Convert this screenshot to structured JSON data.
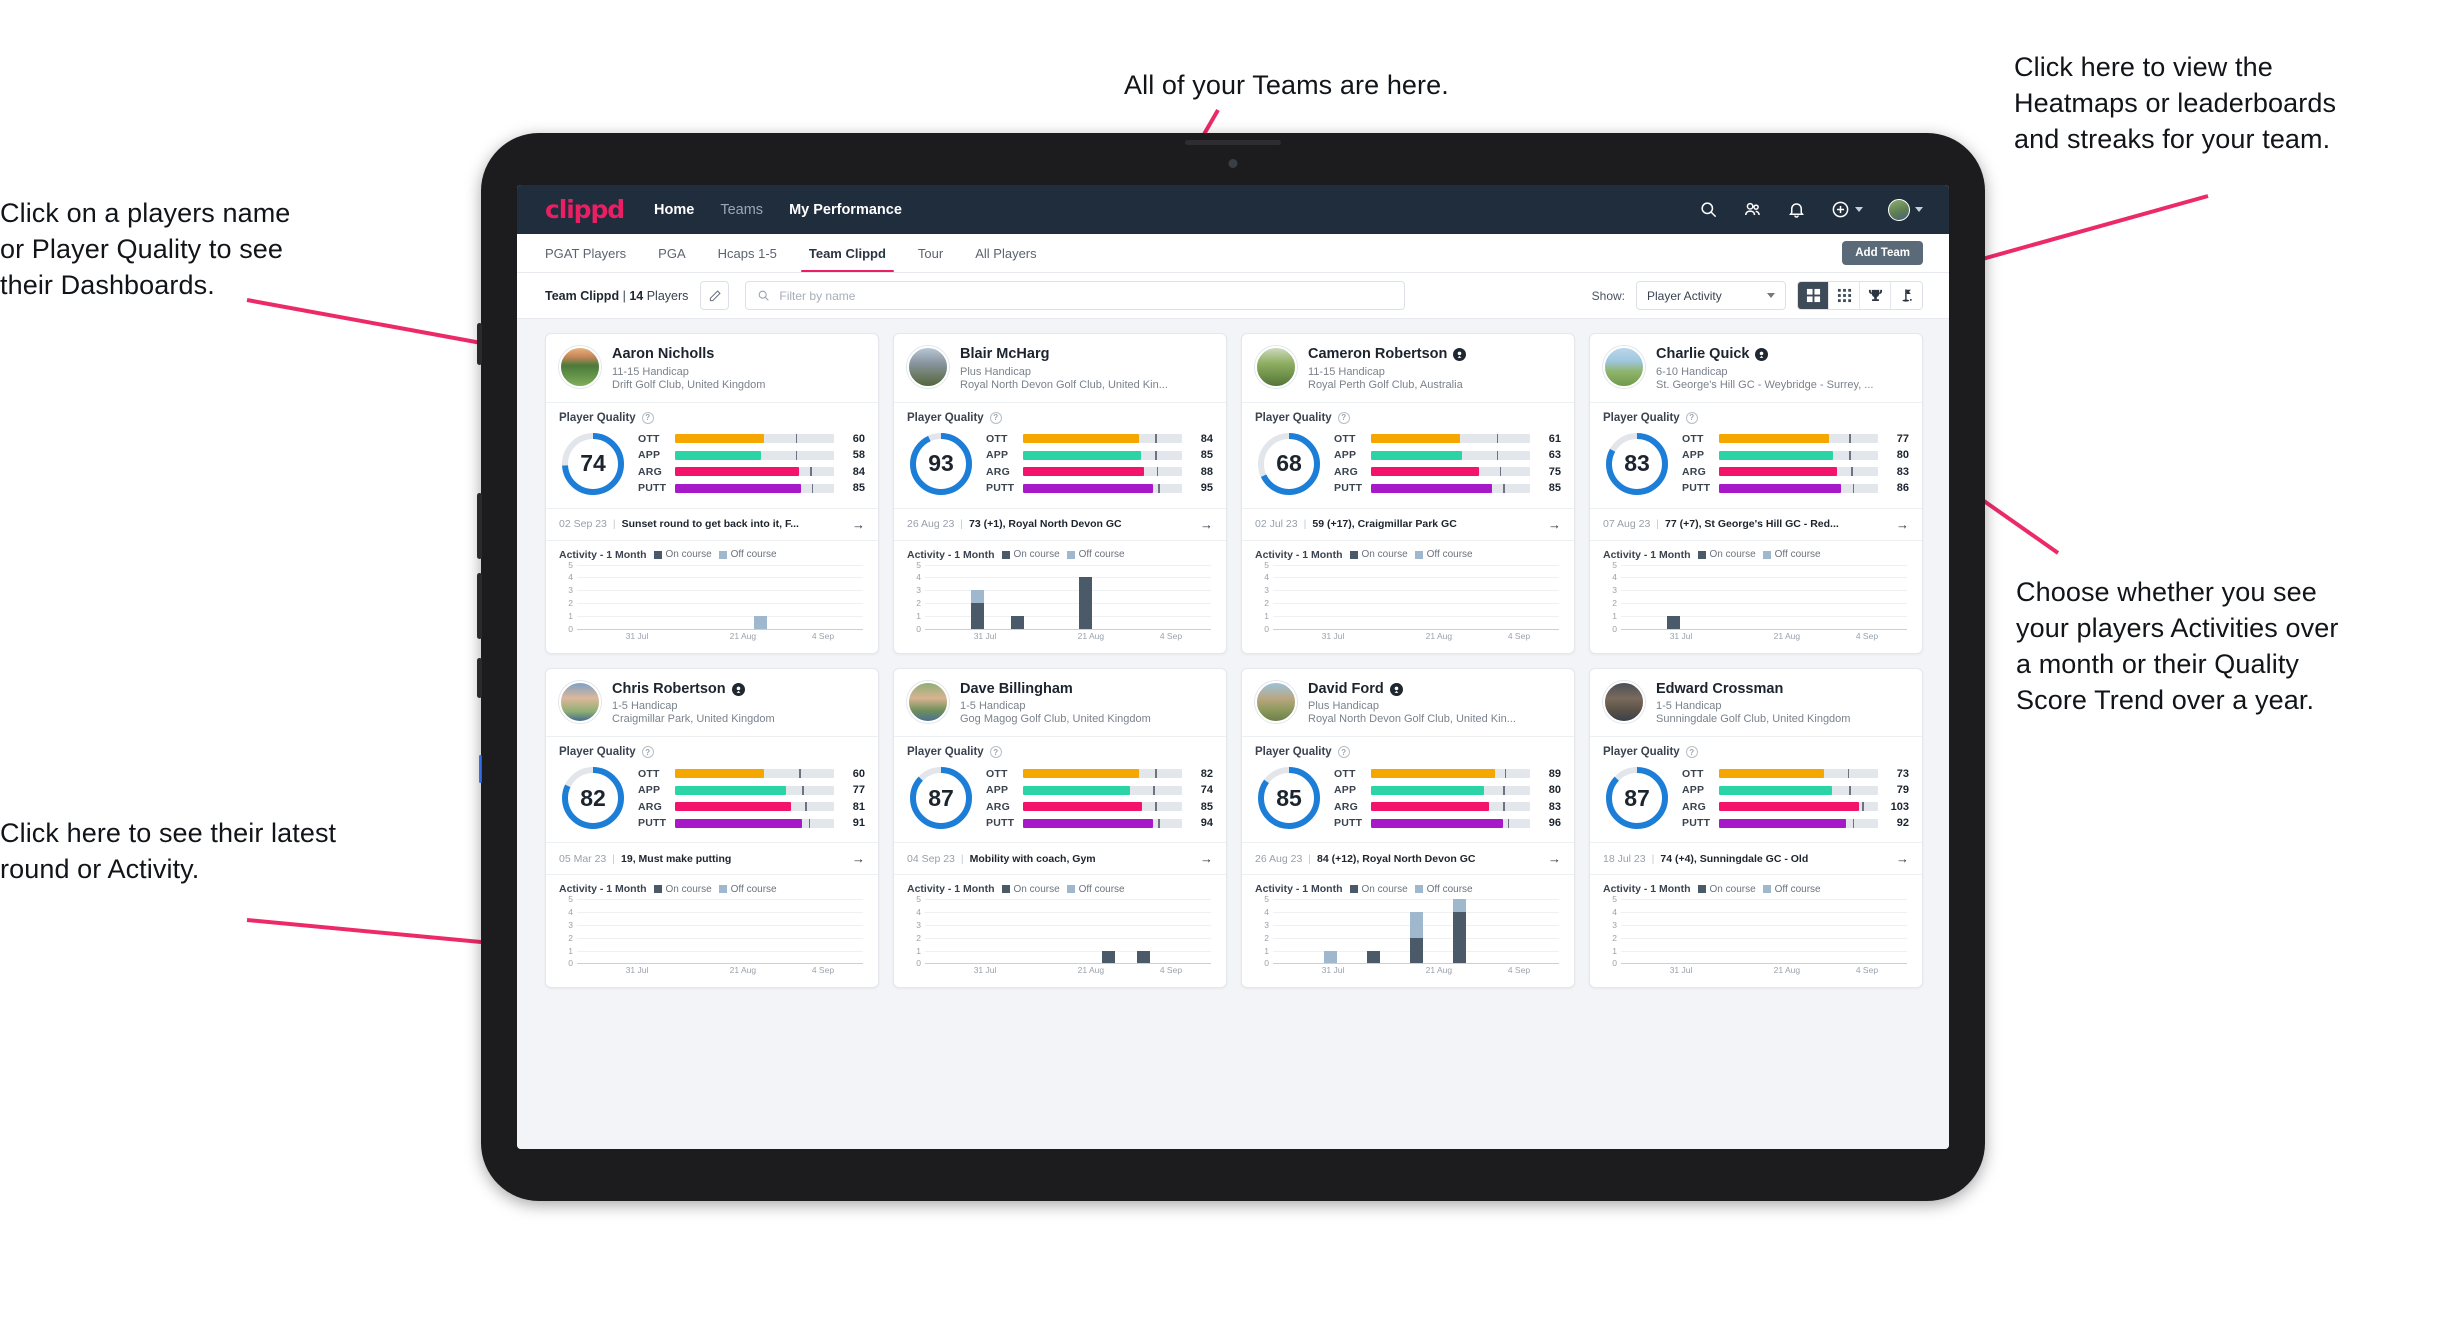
{
  "annotations": [
    {
      "id": "teams-note",
      "text": "All of your Teams are here."
    },
    {
      "id": "heatmap-note",
      "text": "Click here to view the\nHeatmaps or leaderboards\nand streaks for your team."
    },
    {
      "id": "player-name-note",
      "text": "Click on a players name\nor Player Quality to see\ntheir Dashboards."
    },
    {
      "id": "show-note",
      "text": "Choose whether you see\nyour players Activities over\na month or their Quality\nScore Trend over a year."
    },
    {
      "id": "latest-round-note",
      "text": "Click here to see their latest\nround or Activity."
    }
  ],
  "colors": {
    "brand_pink": "#e91e63",
    "nav_dark": "#1f2d3d",
    "accent_blue": "#1d7ed8",
    "ott": "#f5a700",
    "app": "#2bd4a4",
    "arg": "#f4136a",
    "putt": "#a718c9",
    "on_course": "#4a5a68",
    "off_course": "#9fb8cd",
    "annotation_arrow": "#ec2a68"
  },
  "topnav": {
    "brand": "clippd",
    "links": [
      {
        "label": "Home",
        "active": true
      },
      {
        "label": "Teams",
        "active": false
      },
      {
        "label": "My Performance",
        "active": true
      }
    ],
    "icons": [
      {
        "name": "search-icon"
      },
      {
        "name": "people-icon"
      },
      {
        "name": "bell-icon"
      },
      {
        "name": "plus-circle-icon"
      },
      {
        "name": "avatar"
      }
    ]
  },
  "subnav": {
    "tabs": [
      {
        "label": "PGAT Players",
        "active": false
      },
      {
        "label": "PGA",
        "active": false
      },
      {
        "label": "Hcaps 1-5",
        "active": false
      },
      {
        "label": "Team Clippd",
        "active": true
      },
      {
        "label": "Tour",
        "active": false
      },
      {
        "label": "All Players",
        "active": false
      }
    ],
    "add_team_label": "Add Team"
  },
  "filterbar": {
    "team_name": "Team Clippd",
    "separator": "|",
    "player_count": "14",
    "players_word": "Players",
    "edit_icon": "pencil-icon",
    "search_placeholder": "Filter by name",
    "search_value": "",
    "show_label": "Show:",
    "show_value": "Player Activity",
    "show_options": [
      "Player Activity",
      "Quality Score Trend"
    ],
    "view_buttons": [
      {
        "name": "grid-view-icon",
        "active": true
      },
      {
        "name": "dots-grid-view-icon",
        "active": false
      },
      {
        "name": "trophy-view-icon",
        "active": false
      },
      {
        "name": "flag-view-icon",
        "active": false
      }
    ]
  },
  "card_labels": {
    "player_quality": "Player Quality",
    "activity_title": "Activity - 1 Month",
    "legend_on": "On course",
    "legend_off": "Off course",
    "metric_labels": [
      "OTT",
      "APP",
      "ARG",
      "PUTT"
    ],
    "arrow": "→"
  },
  "chart_data": {
    "type": "bar",
    "title": "Activity - 1 Month",
    "xlabel": "",
    "ylabel": "",
    "ylim": [
      0,
      5
    ],
    "grid": true,
    "stacked": true,
    "legend": [
      "On course",
      "Off course"
    ],
    "legend_position": "top",
    "tick_labels_x": [
      "31 Jul",
      "21 Aug",
      "4 Sep"
    ],
    "tick_labels_y": [
      "0",
      "1",
      "2",
      "3",
      "4",
      "5"
    ],
    "charts": [
      {
        "player": "Aaron Nicholls",
        "bars": [
          {
            "pos": 0.62,
            "on": 0,
            "off": 1
          }
        ]
      },
      {
        "player": "Blair McHarg",
        "bars": [
          {
            "pos": 0.16,
            "on": 2,
            "off": 1
          },
          {
            "pos": 0.3,
            "on": 1,
            "off": 0
          },
          {
            "pos": 0.54,
            "on": 4,
            "off": 0
          }
        ]
      },
      {
        "player": "Cameron Robertson",
        "bars": []
      },
      {
        "player": "Charlie Quick",
        "bars": [
          {
            "pos": 0.16,
            "on": 1,
            "off": 0
          }
        ]
      },
      {
        "player": "Chris Robertson",
        "bars": []
      },
      {
        "player": "Dave Billingham",
        "bars": [
          {
            "pos": 0.62,
            "on": 1,
            "off": 0
          },
          {
            "pos": 0.74,
            "on": 1,
            "off": 0
          }
        ]
      },
      {
        "player": "David Ford",
        "bars": [
          {
            "pos": 0.18,
            "on": 0,
            "off": 1
          },
          {
            "pos": 0.33,
            "on": 1,
            "off": 0
          },
          {
            "pos": 0.48,
            "on": 2,
            "off": 2
          },
          {
            "pos": 0.63,
            "on": 4,
            "off": 1
          }
        ]
      },
      {
        "player": "Edward Crossman",
        "bars": []
      }
    ]
  },
  "players": [
    {
      "name": "Aaron Nicholls",
      "verified": false,
      "avatar_class": "pa1",
      "handicap": "11-15 Handicap",
      "club": "Drift Golf Club, United Kingdom",
      "quality": 74,
      "metrics": [
        {
          "label": "OTT",
          "value": 60,
          "color": "#f5a700",
          "fill_pct": 56,
          "tick_pct": 76
        },
        {
          "label": "APP",
          "value": 58,
          "color": "#2bd4a4",
          "fill_pct": 54,
          "tick_pct": 76
        },
        {
          "label": "ARG",
          "value": 84,
          "color": "#f4136a",
          "fill_pct": 78,
          "tick_pct": 85
        },
        {
          "label": "PUTT",
          "value": 85,
          "color": "#a718c9",
          "fill_pct": 79,
          "tick_pct": 86
        }
      ],
      "round_date": "02 Sep 23",
      "round_text": "Sunset round to get back into it, F..."
    },
    {
      "name": "Blair McHarg",
      "verified": false,
      "avatar_class": "pa2",
      "handicap": "Plus Handicap",
      "club": "Royal North Devon Golf Club, United Kin...",
      "quality": 93,
      "metrics": [
        {
          "label": "OTT",
          "value": 84,
          "color": "#f5a700",
          "fill_pct": 73,
          "tick_pct": 83
        },
        {
          "label": "APP",
          "value": 85,
          "color": "#2bd4a4",
          "fill_pct": 74,
          "tick_pct": 83
        },
        {
          "label": "ARG",
          "value": 88,
          "color": "#f4136a",
          "fill_pct": 76,
          "tick_pct": 84
        },
        {
          "label": "PUTT",
          "value": 95,
          "color": "#a718c9",
          "fill_pct": 82,
          "tick_pct": 85
        }
      ],
      "round_date": "26 Aug 23",
      "round_text": "73 (+1), Royal North Devon GC"
    },
    {
      "name": "Cameron Robertson",
      "verified": true,
      "avatar_class": "pa3",
      "handicap": "11-15 Handicap",
      "club": "Royal Perth Golf Club, Australia",
      "quality": 68,
      "metrics": [
        {
          "label": "OTT",
          "value": 61,
          "color": "#f5a700",
          "fill_pct": 56,
          "tick_pct": 79
        },
        {
          "label": "APP",
          "value": 63,
          "color": "#2bd4a4",
          "fill_pct": 57,
          "tick_pct": 79
        },
        {
          "label": "ARG",
          "value": 75,
          "color": "#f4136a",
          "fill_pct": 68,
          "tick_pct": 81
        },
        {
          "label": "PUTT",
          "value": 85,
          "color": "#a718c9",
          "fill_pct": 76,
          "tick_pct": 83
        }
      ],
      "round_date": "02 Jul 23",
      "round_text": "59 (+17), Craigmillar Park GC"
    },
    {
      "name": "Charlie Quick",
      "verified": true,
      "avatar_class": "pa4",
      "handicap": "6-10 Handicap",
      "club": "St. George's Hill GC - Weybridge - Surrey, ...",
      "quality": 83,
      "metrics": [
        {
          "label": "OTT",
          "value": 77,
          "color": "#f5a700",
          "fill_pct": 69,
          "tick_pct": 82
        },
        {
          "label": "APP",
          "value": 80,
          "color": "#2bd4a4",
          "fill_pct": 72,
          "tick_pct": 82
        },
        {
          "label": "ARG",
          "value": 83,
          "color": "#f4136a",
          "fill_pct": 74,
          "tick_pct": 83
        },
        {
          "label": "PUTT",
          "value": 86,
          "color": "#a718c9",
          "fill_pct": 77,
          "tick_pct": 84
        }
      ],
      "round_date": "07 Aug 23",
      "round_text": "77 (+7), St George's Hill GC - Red..."
    },
    {
      "name": "Chris Robertson",
      "verified": true,
      "avatar_class": "pa5",
      "handicap": "1-5 Handicap",
      "club": "Craigmillar Park, United Kingdom",
      "quality": 82,
      "metrics": [
        {
          "label": "OTT",
          "value": 60,
          "color": "#f5a700",
          "fill_pct": 56,
          "tick_pct": 78
        },
        {
          "label": "APP",
          "value": 77,
          "color": "#2bd4a4",
          "fill_pct": 70,
          "tick_pct": 80
        },
        {
          "label": "ARG",
          "value": 81,
          "color": "#f4136a",
          "fill_pct": 73,
          "tick_pct": 82
        },
        {
          "label": "PUTT",
          "value": 91,
          "color": "#a718c9",
          "fill_pct": 80,
          "tick_pct": 84
        }
      ],
      "round_date": "05 Mar 23",
      "round_text": "19, Must make putting"
    },
    {
      "name": "Dave Billingham",
      "verified": false,
      "avatar_class": "pa6",
      "handicap": "1-5 Handicap",
      "club": "Gog Magog Golf Club, United Kingdom",
      "quality": 87,
      "metrics": [
        {
          "label": "OTT",
          "value": 82,
          "color": "#f5a700",
          "fill_pct": 73,
          "tick_pct": 83
        },
        {
          "label": "APP",
          "value": 74,
          "color": "#2bd4a4",
          "fill_pct": 67,
          "tick_pct": 82
        },
        {
          "label": "ARG",
          "value": 85,
          "color": "#f4136a",
          "fill_pct": 75,
          "tick_pct": 83
        },
        {
          "label": "PUTT",
          "value": 94,
          "color": "#a718c9",
          "fill_pct": 82,
          "tick_pct": 85
        }
      ],
      "round_date": "04 Sep 23",
      "round_text": "Mobility with coach, Gym"
    },
    {
      "name": "David Ford",
      "verified": true,
      "avatar_class": "pa7",
      "handicap": "Plus Handicap",
      "club": "Royal North Devon Golf Club, United Kin...",
      "quality": 85,
      "metrics": [
        {
          "label": "OTT",
          "value": 89,
          "color": "#f5a700",
          "fill_pct": 78,
          "tick_pct": 84
        },
        {
          "label": "APP",
          "value": 80,
          "color": "#2bd4a4",
          "fill_pct": 71,
          "tick_pct": 83
        },
        {
          "label": "ARG",
          "value": 83,
          "color": "#f4136a",
          "fill_pct": 74,
          "tick_pct": 83
        },
        {
          "label": "PUTT",
          "value": 96,
          "color": "#a718c9",
          "fill_pct": 83,
          "tick_pct": 86
        }
      ],
      "round_date": "26 Aug 23",
      "round_text": "84 (+12), Royal North Devon GC"
    },
    {
      "name": "Edward Crossman",
      "verified": false,
      "avatar_class": "pa8",
      "handicap": "1-5 Handicap",
      "club": "Sunningdale Golf Club, United Kingdom",
      "quality": 87,
      "metrics": [
        {
          "label": "OTT",
          "value": 73,
          "color": "#f5a700",
          "fill_pct": 66,
          "tick_pct": 81
        },
        {
          "label": "APP",
          "value": 79,
          "color": "#2bd4a4",
          "fill_pct": 71,
          "tick_pct": 82
        },
        {
          "label": "ARG",
          "value": 103,
          "color": "#f4136a",
          "fill_pct": 88,
          "tick_pct": 90
        },
        {
          "label": "PUTT",
          "value": 92,
          "color": "#a718c9",
          "fill_pct": 80,
          "tick_pct": 84
        }
      ],
      "round_date": "18 Jul 23",
      "round_text": "74 (+4), Sunningdale GC - Old"
    }
  ]
}
